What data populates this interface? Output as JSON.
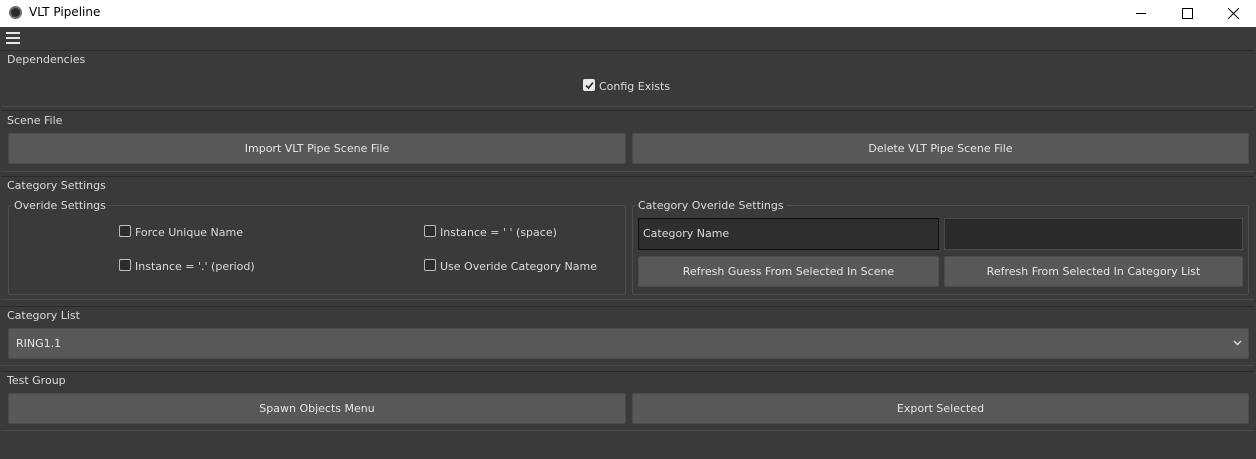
{
  "window": {
    "title": "VLT Pipeline",
    "icon": "cinema4d-logo-icon",
    "controls": [
      "minimize-icon",
      "maximize-icon",
      "close-icon"
    ]
  },
  "menubar": {
    "icon": "hamburger-menu-icon"
  },
  "dependencies": {
    "label": "Dependencies",
    "config_exists": {
      "label": "Config Exists",
      "checked": true
    }
  },
  "scene_file": {
    "label": "Scene File",
    "import_label": "Import VLT Pipe Scene File",
    "delete_label": "Delete VLT Pipe Scene File"
  },
  "category_settings": {
    "label": "Category Settings",
    "override": {
      "label": "Overide Settings",
      "force_unique_name": "Force Unique Name",
      "instance_space": "Instance = ' ' (space)",
      "instance_period": "Instance = '.' (period)",
      "use_override_name": "Use Overide Category Name"
    },
    "category_override": {
      "label": "Category Overide Settings",
      "category_name_value": "Category Name",
      "override_name_value": "",
      "refresh_guess_label": "Refresh Guess From Selected In Scene",
      "refresh_list_label": "Refresh From Selected In Category List"
    }
  },
  "category_list": {
    "label": "Category List",
    "selected": "RING1.1"
  },
  "test_group": {
    "label": "Test Group",
    "spawn_label": "Spawn Objects Menu",
    "export_label": "Export Selected"
  }
}
